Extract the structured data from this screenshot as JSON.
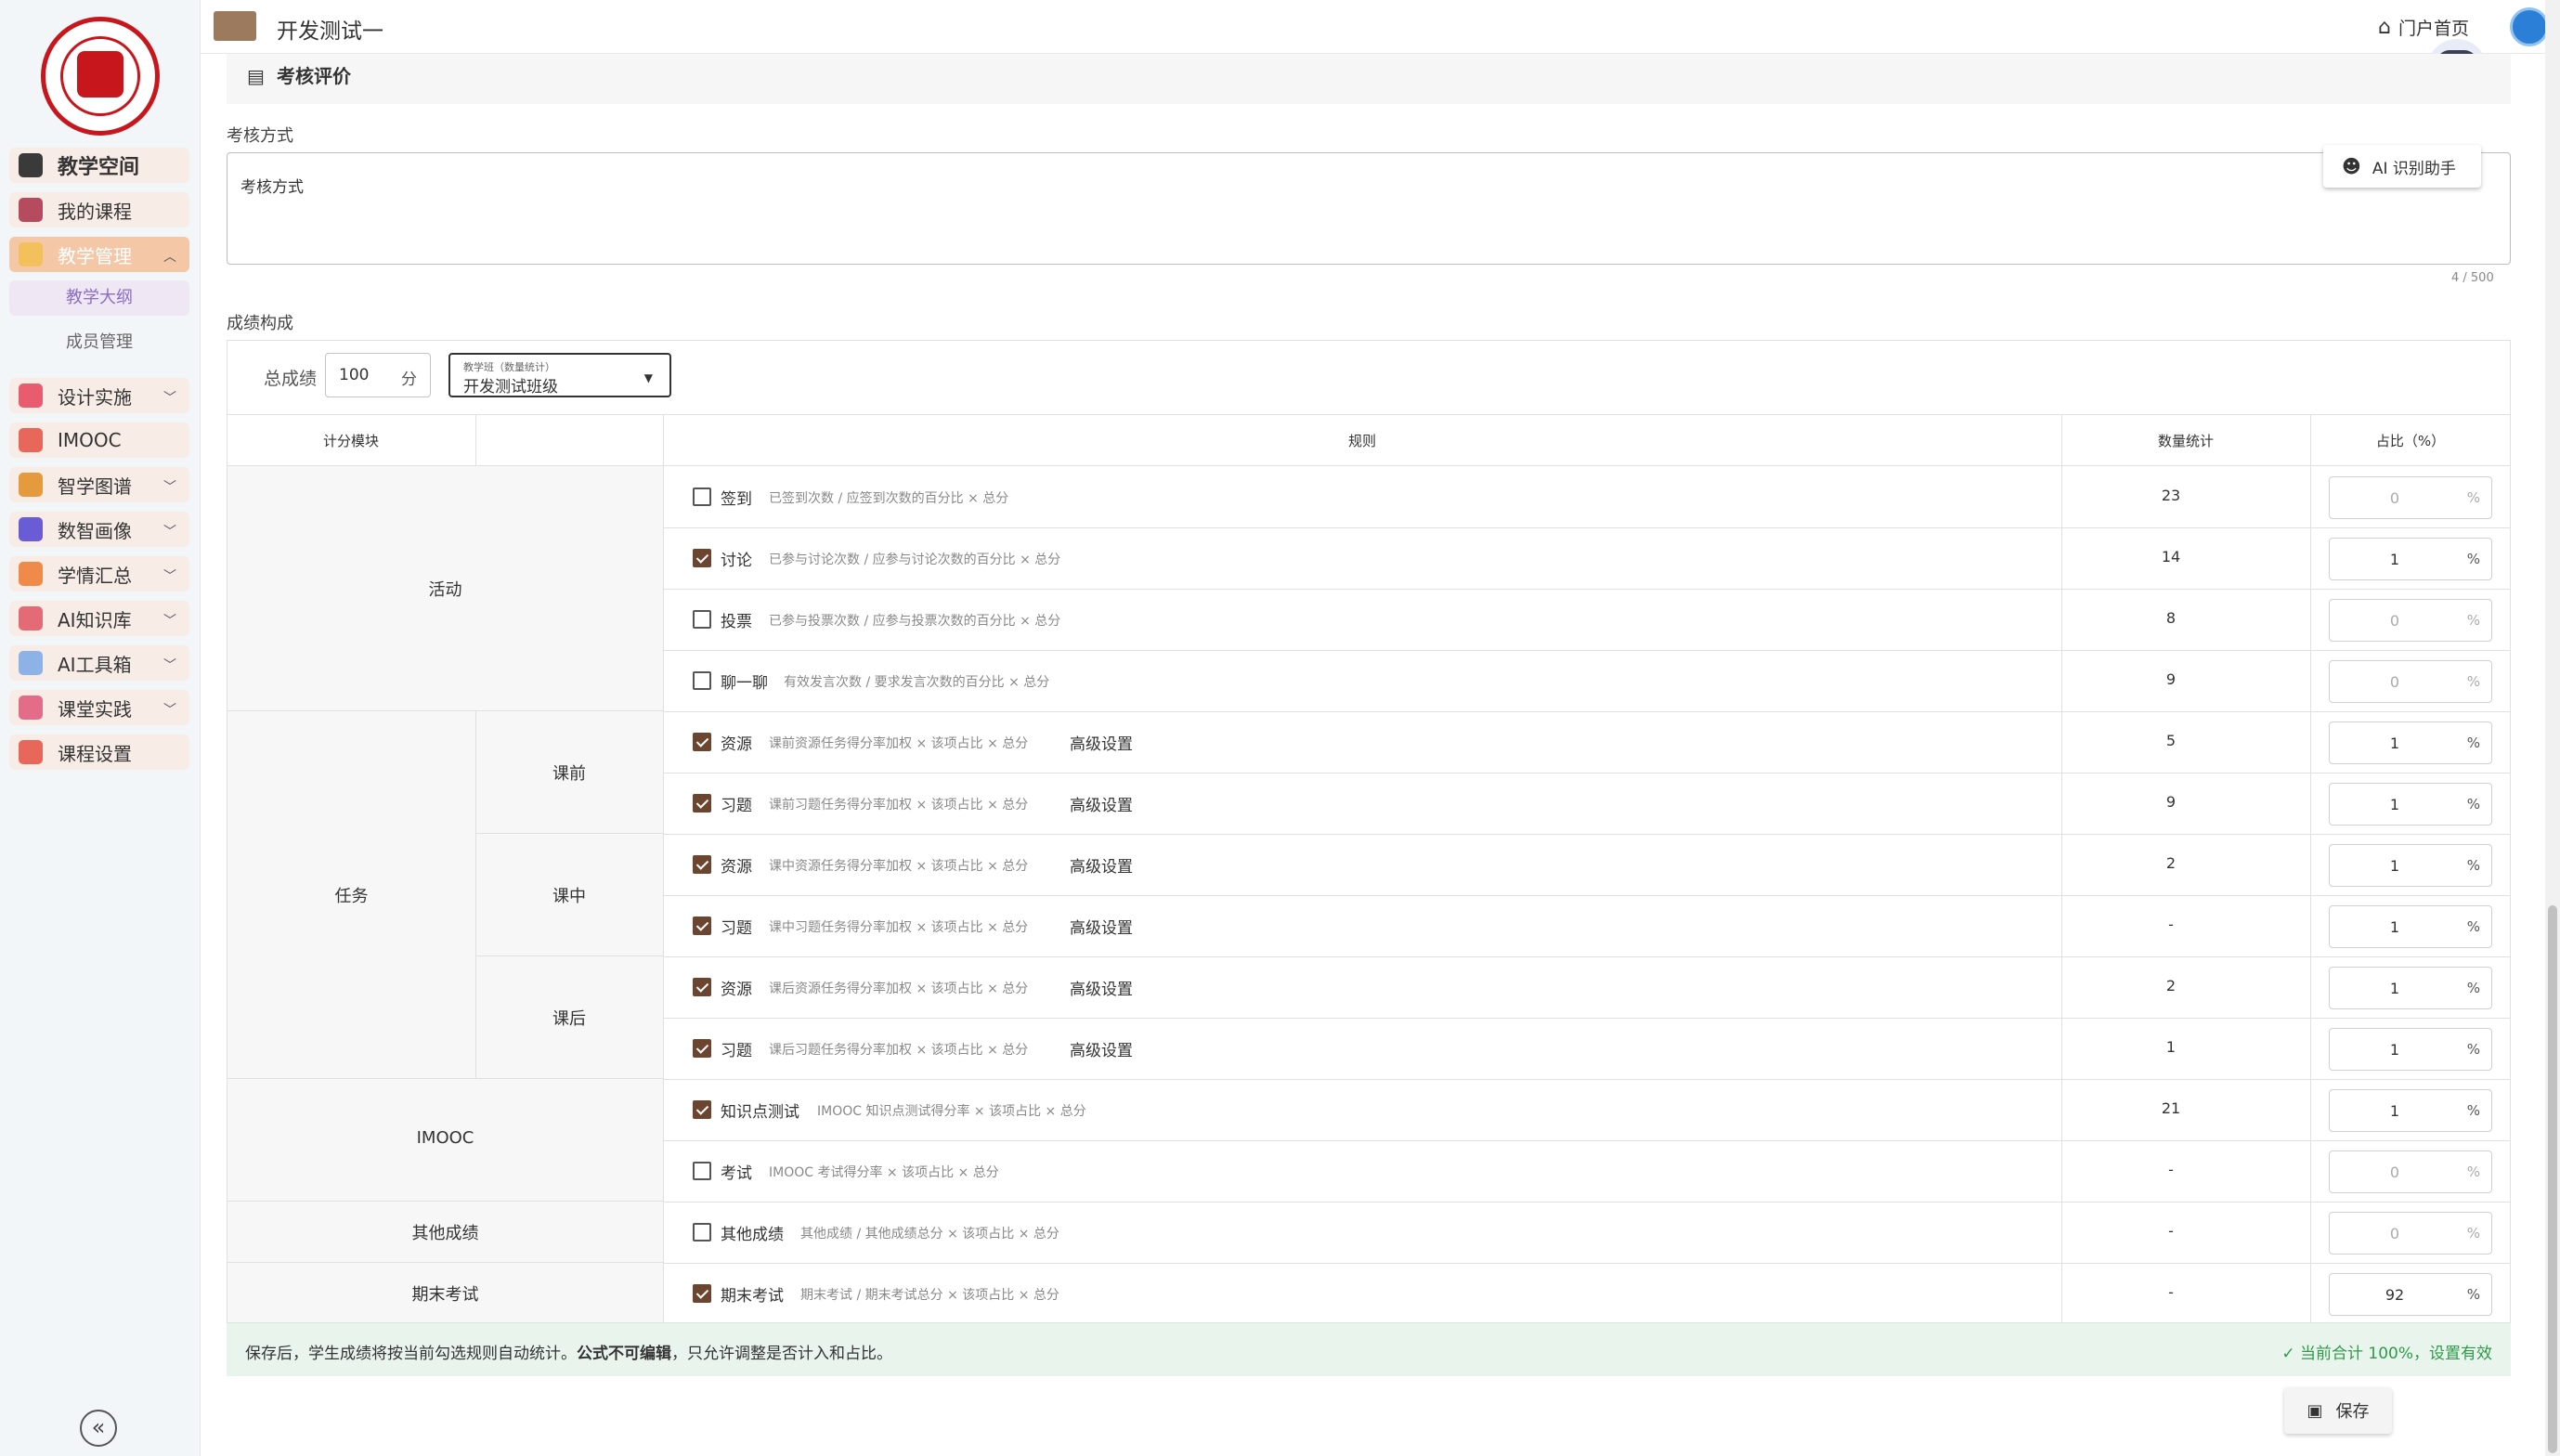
{
  "window": {
    "course_title": "开发测试一",
    "home_label": "门户首页"
  },
  "sidebar": {
    "items": [
      {
        "label": "教学空间",
        "icon": "book-icon",
        "color": "#3a3a3a"
      },
      {
        "label": "我的课程",
        "icon": "open-book-icon",
        "color": "#b64a5f"
      },
      {
        "label": "教学管理",
        "icon": "pencil-icon",
        "color": "#f4c05b"
      },
      {
        "label": "设计实施",
        "icon": "design-icon",
        "color": "#e85c6d"
      },
      {
        "label": "IMOOC",
        "icon": "target-icon",
        "color": "#e8675a"
      },
      {
        "label": "智学图谱",
        "icon": "graph-icon",
        "color": "#e59a3d"
      },
      {
        "label": "数智画像",
        "icon": "portrait-icon",
        "color": "#6a5bd6"
      },
      {
        "label": "学情汇总",
        "icon": "trend-icon",
        "color": "#f08a4b"
      },
      {
        "label": "AI知识库",
        "icon": "database-icon",
        "color": "#e46b76"
      },
      {
        "label": "AI工具箱",
        "icon": "robot-icon",
        "color": "#8db2e8"
      },
      {
        "label": "课堂实践",
        "icon": "flag-icon",
        "color": "#e36d88"
      },
      {
        "label": "课程设置",
        "icon": "settings-icon",
        "color": "#e8675a"
      }
    ],
    "sub_items": [
      "教学大纲",
      "成员管理"
    ]
  },
  "section": {
    "title": "考核评价"
  },
  "assessment": {
    "label": "考核方式",
    "value": "考核方式",
    "counter": "4 / 500",
    "ai_button": "AI 识别助手"
  },
  "grade": {
    "label": "成绩构成",
    "total_label": "总成绩",
    "total_value": "100",
    "total_unit": "分",
    "class_caption": "教学班（数量统计）",
    "class_value": "开发测试班级"
  },
  "table": {
    "headers": {
      "module": "计分模块",
      "rule": "规则",
      "count": "数量统计",
      "ratio": "占比（%）"
    },
    "groups": {
      "activity": "活动",
      "task": "任务",
      "imooc": "IMOOC",
      "other": "其他成绩",
      "final": "期末考试"
    },
    "stages": {
      "before": "课前",
      "during": "课中",
      "after": "课后"
    },
    "advanced_label": "高级设置",
    "percent_unit": "%",
    "rows": [
      {
        "name": "签到",
        "formula": "已签到次数 / 应签到次数的百分比 × 总分",
        "checked": false,
        "count": "23",
        "ratio": "0",
        "advanced": false
      },
      {
        "name": "讨论",
        "formula": "已参与讨论次数 / 应参与讨论次数的百分比 × 总分",
        "checked": true,
        "count": "14",
        "ratio": "1",
        "advanced": false
      },
      {
        "name": "投票",
        "formula": "已参与投票次数 / 应参与投票次数的百分比 × 总分",
        "checked": false,
        "count": "8",
        "ratio": "0",
        "advanced": false
      },
      {
        "name": "聊一聊",
        "formula": "有效发言次数 / 要求发言次数的百分比 × 总分",
        "checked": false,
        "count": "9",
        "ratio": "0",
        "advanced": false
      },
      {
        "name": "资源",
        "formula": "课前资源任务得分率加权 × 该项占比 × 总分",
        "checked": true,
        "count": "5",
        "ratio": "1",
        "advanced": true
      },
      {
        "name": "习题",
        "formula": "课前习题任务得分率加权 × 该项占比 × 总分",
        "checked": true,
        "count": "9",
        "ratio": "1",
        "advanced": true
      },
      {
        "name": "资源",
        "formula": "课中资源任务得分率加权 × 该项占比 × 总分",
        "checked": true,
        "count": "2",
        "ratio": "1",
        "advanced": true
      },
      {
        "name": "习题",
        "formula": "课中习题任务得分率加权 × 该项占比 × 总分",
        "checked": true,
        "count": "-",
        "ratio": "1",
        "advanced": true
      },
      {
        "name": "资源",
        "formula": "课后资源任务得分率加权 × 该项占比 × 总分",
        "checked": true,
        "count": "2",
        "ratio": "1",
        "advanced": true
      },
      {
        "name": "习题",
        "formula": "课后习题任务得分率加权 × 该项占比 × 总分",
        "checked": true,
        "count": "1",
        "ratio": "1",
        "advanced": true
      },
      {
        "name": "知识点测试",
        "formula": "IMOOC 知识点测试得分率 × 该项占比 × 总分",
        "checked": true,
        "count": "21",
        "ratio": "1",
        "advanced": false
      },
      {
        "name": "考试",
        "formula": "IMOOC 考试得分率 × 该项占比 × 总分",
        "checked": false,
        "count": "-",
        "ratio": "0",
        "advanced": false
      },
      {
        "name": "其他成绩",
        "formula": "其他成绩 / 其他成绩总分 × 该项占比 × 总分",
        "checked": false,
        "count": "-",
        "ratio": "0",
        "advanced": false
      },
      {
        "name": "期末考试",
        "formula": "期末考试 / 期末考试总分 × 该项占比 × 总分",
        "checked": true,
        "count": "-",
        "ratio": "92",
        "advanced": false
      }
    ]
  },
  "notice": {
    "text_prefix": "保存后，学生成绩将按当前勾选规则自动统计。",
    "text_bold": "公式不可编辑",
    "text_suffix": "，只允许调整是否计入和占比。",
    "status": "当前合计 100%，设置有效"
  },
  "save_label": "保存",
  "colors": {
    "accent": "#6b4530",
    "success": "#2e9a4a",
    "active_nav": "#f4c7a7"
  }
}
